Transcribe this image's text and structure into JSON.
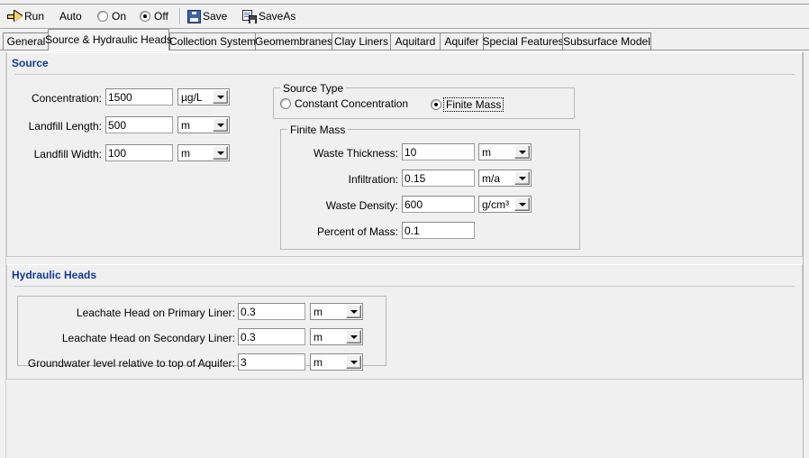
{
  "window": {
    "menu_fragment": "",
    "background_color": "#f0f0f0",
    "accent_color": "#123a8f"
  },
  "toolbar": {
    "run_label": "Run",
    "auto_label": "Auto",
    "auto_on_label": "On",
    "auto_off_label": "Off",
    "auto_selected": "Off",
    "save_label": "Save",
    "saveas_label": "SaveAs"
  },
  "tabs": {
    "active": "Source & Hydraulic Heads",
    "items": [
      {
        "label": "General"
      },
      {
        "label": "Source & Hydraulic Heads"
      },
      {
        "label": "Collection System"
      },
      {
        "label": "Geomembranes"
      },
      {
        "label": "Clay Liners"
      },
      {
        "label": "Aquitard"
      },
      {
        "label": "Aquifer"
      },
      {
        "label": "Special Features"
      },
      {
        "label": "Subsurface Model"
      }
    ]
  },
  "source": {
    "title": "Source",
    "fields": [
      {
        "label": "Concentration:",
        "value": "1500",
        "unit": "µg/L"
      },
      {
        "label": "Landfill Length:",
        "value": "500",
        "unit": "m"
      },
      {
        "label": "Landfill Width:",
        "value": "100",
        "unit": "m"
      }
    ],
    "source_type": {
      "title": "Source Type",
      "options": [
        {
          "label": "Constant Concentration",
          "selected": false,
          "focused": false
        },
        {
          "label": "Finite Mass",
          "selected": true,
          "focused": true
        }
      ]
    },
    "finite_mass": {
      "title": "Finite Mass",
      "fields": [
        {
          "label": "Waste Thickness:",
          "value": "10",
          "unit": "m"
        },
        {
          "label": "Infiltration:",
          "value": "0.15",
          "unit": "m/a"
        },
        {
          "label": "Waste Density:",
          "value": "600",
          "unit": "g/cm³"
        },
        {
          "label": "Percent of Mass:",
          "value": "0.1",
          "unit": null
        }
      ]
    }
  },
  "hydraulic_heads": {
    "title": "Hydraulic Heads",
    "fields": [
      {
        "label": "Leachate Head on Primary Liner:",
        "value": "0.3",
        "unit": "m"
      },
      {
        "label": "Leachate Head on Secondary Liner:",
        "value": "0.3",
        "unit": "m"
      },
      {
        "label": "Groundwater level relative to top of Aquifer:",
        "value": "3",
        "unit": "m"
      }
    ]
  }
}
